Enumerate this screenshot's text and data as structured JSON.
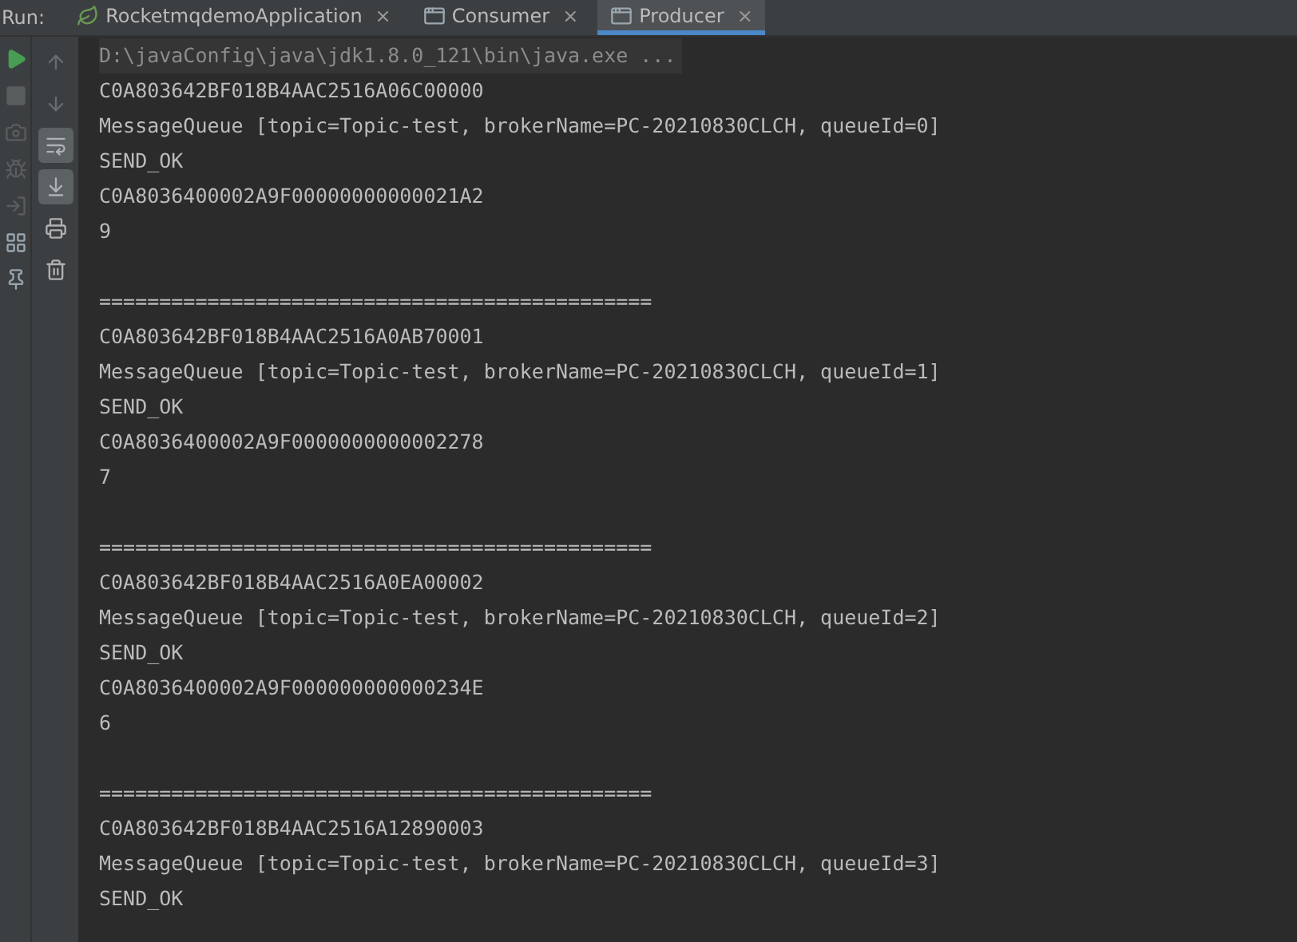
{
  "run_label": "Run:",
  "tabs": [
    {
      "label": "RocketmqdemoApplication",
      "close": "×",
      "kind": "spring",
      "selected": false
    },
    {
      "label": "Consumer",
      "close": "×",
      "kind": "console",
      "selected": false
    },
    {
      "label": "Producer",
      "close": "×",
      "kind": "console",
      "selected": true
    }
  ],
  "left_toolbar": [
    {
      "kind": "run",
      "disabled": false
    },
    {
      "kind": "stop",
      "disabled": true
    },
    {
      "kind": "camera",
      "disabled": true
    },
    {
      "kind": "bug",
      "disabled": true
    },
    {
      "kind": "exit",
      "disabled": true
    },
    {
      "kind": "layout",
      "disabled": false
    },
    {
      "kind": "pin",
      "disabled": false
    }
  ],
  "console_toolbar": [
    {
      "kind": "up",
      "on": false
    },
    {
      "kind": "down",
      "on": false
    },
    {
      "kind": "wrap",
      "on": true
    },
    {
      "kind": "scroll-end",
      "on": true
    },
    {
      "kind": "print",
      "on": false
    },
    {
      "kind": "trash",
      "on": false
    }
  ],
  "output": [
    {
      "kind": "command",
      "text": "D:\\javaConfig\\java\\jdk1.8.0_121\\bin\\java.exe ..."
    },
    {
      "kind": "text",
      "text": "C0A803642BF018B4AAC2516A06C00000"
    },
    {
      "kind": "text",
      "text": "MessageQueue [topic=Topic-test, brokerName=PC-20210830CLCH, queueId=0]"
    },
    {
      "kind": "text",
      "text": "SEND_OK"
    },
    {
      "kind": "text",
      "text": "C0A8036400002A9F00000000000021A2"
    },
    {
      "kind": "text",
      "text": "9"
    },
    {
      "kind": "blank"
    },
    {
      "kind": "text",
      "text": "=============================================="
    },
    {
      "kind": "text",
      "text": "C0A803642BF018B4AAC2516A0AB70001"
    },
    {
      "kind": "text",
      "text": "MessageQueue [topic=Topic-test, brokerName=PC-20210830CLCH, queueId=1]"
    },
    {
      "kind": "text",
      "text": "SEND_OK"
    },
    {
      "kind": "text",
      "text": "C0A8036400002A9F0000000000002278"
    },
    {
      "kind": "text",
      "text": "7"
    },
    {
      "kind": "blank"
    },
    {
      "kind": "text",
      "text": "=============================================="
    },
    {
      "kind": "text",
      "text": "C0A803642BF018B4AAC2516A0EA00002"
    },
    {
      "kind": "text",
      "text": "MessageQueue [topic=Topic-test, brokerName=PC-20210830CLCH, queueId=2]"
    },
    {
      "kind": "text",
      "text": "SEND_OK"
    },
    {
      "kind": "text",
      "text": "C0A8036400002A9F000000000000234E"
    },
    {
      "kind": "text",
      "text": "6"
    },
    {
      "kind": "blank"
    },
    {
      "kind": "text",
      "text": "=============================================="
    },
    {
      "kind": "text",
      "text": "C0A803642BF018B4AAC2516A12890003"
    },
    {
      "kind": "text",
      "text": "MessageQueue [topic=Topic-test, brokerName=PC-20210830CLCH, queueId=3]"
    },
    {
      "kind": "text",
      "text": "SEND_OK"
    }
  ]
}
